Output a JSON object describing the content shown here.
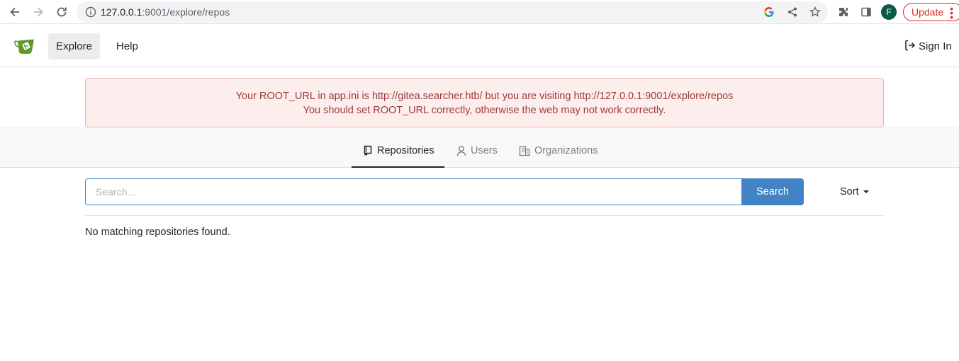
{
  "browser": {
    "url_host": "127.0.0.1",
    "url_rest": ":9001/explore/repos",
    "profile_initial": "F",
    "update_label": "Update"
  },
  "header": {
    "nav": {
      "explore": "Explore",
      "help": "Help"
    },
    "sign_in": "Sign In"
  },
  "flash": {
    "line1": "Your ROOT_URL in app.ini is http://gitea.searcher.htb/ but you are visiting http://127.0.0.1:9001/explore/repos",
    "line2": "You should set ROOT_URL correctly, otherwise the web may not work correctly."
  },
  "tabs": [
    {
      "label": "Repositories",
      "icon": "repo-icon",
      "active": true
    },
    {
      "label": "Users",
      "icon": "person-icon",
      "active": false
    },
    {
      "label": "Organizations",
      "icon": "organization-icon",
      "active": false
    }
  ],
  "search": {
    "placeholder": "Search...",
    "value": "",
    "button_label": "Search"
  },
  "sort": {
    "label": "Sort"
  },
  "results": {
    "empty_message": "No matching repositories found."
  },
  "colors": {
    "accent": "#4183c4",
    "flash_bg": "#fbeeec",
    "flash_text": "#9f3a38",
    "update_red": "#d93025",
    "profile_green": "#0b5a45",
    "logo_green": "#609926"
  }
}
